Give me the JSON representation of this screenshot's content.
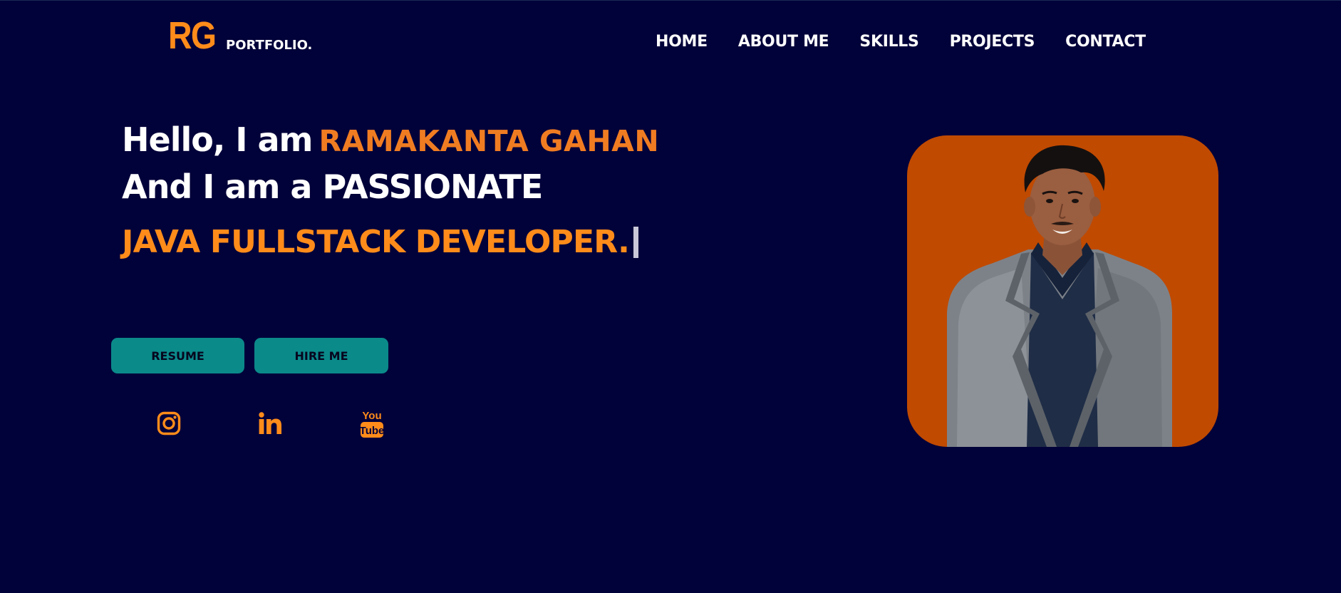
{
  "header": {
    "logo_mark": "RG",
    "logo_text": "PORTFOLIO.",
    "nav": [
      {
        "label": "HOME"
      },
      {
        "label": "ABOUT ME"
      },
      {
        "label": "SKILLS"
      },
      {
        "label": "PROJECTS"
      },
      {
        "label": "CONTACT"
      }
    ]
  },
  "hero": {
    "greeting": "Hello, I am",
    "name": "RAMAKANTA GAHAN",
    "intro": "And I am a PASSIONATE",
    "role": "JAVA FULLSTACK DEVELOPER."
  },
  "buttons": {
    "resume": "RESUME",
    "hire": "HIRE ME"
  },
  "social": [
    {
      "icon": "instagram-icon"
    },
    {
      "icon": "linkedin-icon"
    },
    {
      "icon": "youtube-icon"
    }
  ],
  "colors": {
    "background": "#02023a",
    "accent_orange": "#ff8c1a",
    "name_orange": "#f07c22",
    "button_teal": "#0b8a8a",
    "photo_background": "#c04a00"
  }
}
